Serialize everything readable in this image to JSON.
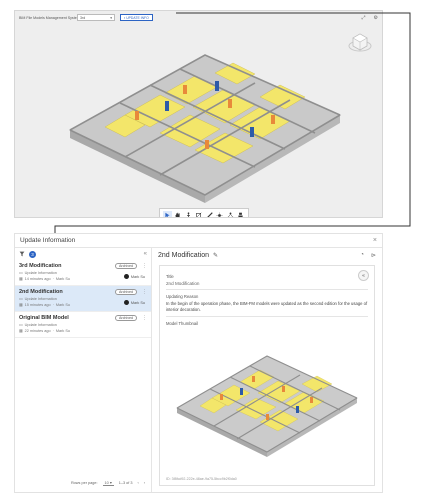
{
  "viewer": {
    "title": "BIM File Models Management System (BFMM)",
    "version_select": "3rd",
    "update_button": "UPDATE INFO",
    "toolbar_icons": [
      "cursor-icon",
      "pan-hand-icon",
      "walk-icon",
      "section-box-icon",
      "measure-icon",
      "explode-icon",
      "model-tree-icon",
      "properties-icon"
    ]
  },
  "dialog": {
    "title": "Update Information",
    "close": "×",
    "filter_count": "3",
    "items": [
      {
        "title": "3rd Modification",
        "subtitle": "Update Information",
        "time": "14 minutes ago",
        "author": "Mark Su",
        "status": "Archived"
      },
      {
        "title": "2nd Modification",
        "subtitle": "Update Information",
        "time": "15 minutes ago",
        "author": "Mark Su",
        "status": "Archived"
      },
      {
        "title": "Original BIM Model",
        "subtitle": "Update Information",
        "time": "22 minutes ago",
        "author": "Mark Su",
        "status": "Archived"
      }
    ],
    "pager": {
      "rows_label": "Rows per page:",
      "rows_value": "10",
      "range": "1–3 of 3"
    },
    "detail": {
      "title": "2nd Modification",
      "title_label": "Title",
      "title_value": "2nd Modification",
      "reason_label": "Updating Reason",
      "reason_text": "In the begin of the operation phase, the BIM-FM models were updated as the second edition for the usage of interior decoration.",
      "thumbnail_label": "Model Thumbnail",
      "id_text": "ID: 3f8fcd92-222e-48ae-9a75-5bcc9b2f0da0"
    }
  },
  "colors": {
    "accent": "#2c64c4",
    "selected_row": "#dce9f8",
    "floor_yellow": "#f3e66a",
    "wall_grey": "#d9d9d9",
    "door_orange": "#e8893a",
    "door_blue": "#2d5ba8"
  }
}
